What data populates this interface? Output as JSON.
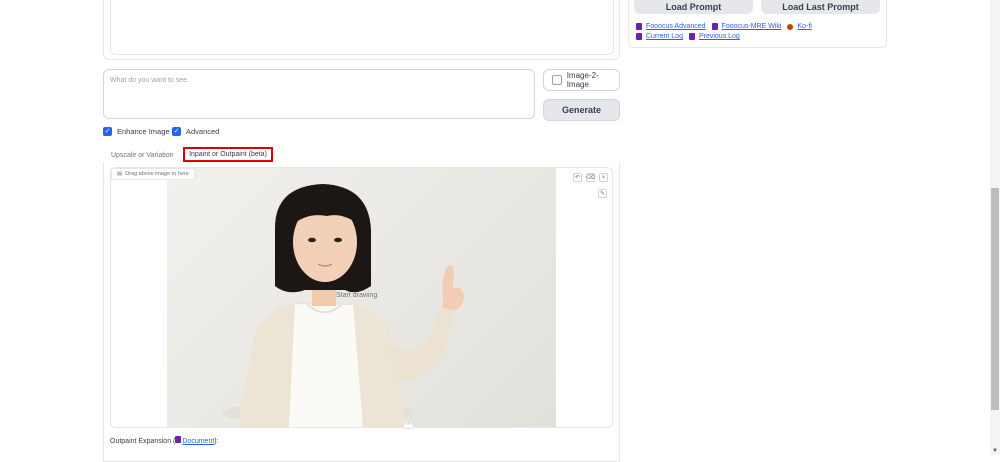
{
  "right_panel": {
    "load_prompt": "Load Prompt",
    "load_last_prompt": "Load Last Prompt",
    "links_row1": [
      "Fooocus Advanced",
      "Fooocus-MRE Wiki",
      "Ko-fi"
    ],
    "links_row2": [
      "Current Log",
      "Previous Log"
    ]
  },
  "prompt": {
    "placeholder": "What do you want to see.",
    "value": ""
  },
  "image2image": {
    "label": "Image-2-Image",
    "checked": false
  },
  "generate": {
    "label": "Generate"
  },
  "options": {
    "enhance_image": {
      "label": "Enhance Image",
      "checked": true
    },
    "advanced": {
      "label": "Advanced",
      "checked": true
    }
  },
  "tabs": [
    {
      "label": "Upscale or Variation",
      "selected": false
    },
    {
      "label": "Inpaint or Outpaint (beta)",
      "selected": true
    }
  ],
  "canvas": {
    "drag_label": "Drag above image to here",
    "start_drawing": "Start drawing",
    "tools": [
      "undo-icon",
      "clear-icon",
      "close-icon",
      "brush-icon"
    ]
  },
  "outpaint": {
    "prefix": "Outpaint Expansion (",
    "link": "Document",
    "suffix": "):"
  },
  "colors": {
    "accent": "#2563eb",
    "highlight_border": "#dd0000",
    "button_bg": "#e5e7eb"
  }
}
